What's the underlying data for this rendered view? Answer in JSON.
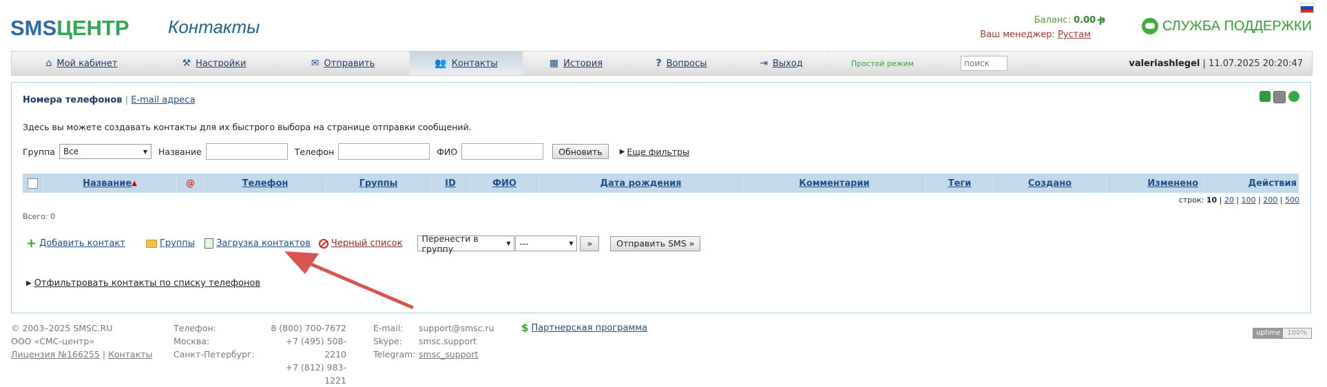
{
  "brand": {
    "sms": "SMS",
    "center": "ЦЕНТР"
  },
  "page_title": "Контакты",
  "balance": {
    "label": "Баланс:",
    "value": "0.00 р"
  },
  "manager": {
    "label": "Ваш менеджер:",
    "name": "Рустам"
  },
  "support": "СЛУЖБА ПОДДЕРЖКИ",
  "nav": {
    "items": [
      {
        "label": "Мой кабинет",
        "icon": "home-icon"
      },
      {
        "label": "Настройки",
        "icon": "tools-icon"
      },
      {
        "label": "Отправить",
        "icon": "envelope-icon"
      },
      {
        "label": "Контакты",
        "icon": "users-icon"
      },
      {
        "label": "История",
        "icon": "calendar-icon"
      },
      {
        "label": "Вопросы",
        "icon": "question-icon"
      },
      {
        "label": "Выход",
        "icon": "logout-icon"
      }
    ],
    "simple_mode": "Простой режим",
    "search_placeholder": "поиск",
    "username": "valeriashlegel",
    "datetime": "11.07.2025 20:20:47"
  },
  "tabs": {
    "phones": "Номера телефонов",
    "separator": "|",
    "emails": "E-mail адреса"
  },
  "intro": "Здесь вы можете создавать контакты для их быстрого выбора на странице отправки сообщений.",
  "filters": {
    "group_label": "Группа",
    "group_value": "Все",
    "name_label": "Название",
    "phone_label": "Телефон",
    "fio_label": "ФИО",
    "refresh_button": "Обновить",
    "more_filters": "Еще фильтры"
  },
  "table": {
    "columns": [
      "Название",
      "@",
      "Телефон",
      "Группы",
      "ID",
      "ФИО",
      "Дата рождения",
      "Комментарии",
      "Теги",
      "Создано",
      "Изменено",
      "Действия"
    ],
    "total": "Всего: 0",
    "rows_label": "строк:",
    "rows_current": "10",
    "rows_options": [
      "20",
      "100",
      "200",
      "500"
    ]
  },
  "actions": {
    "add_contact": "Добавить контакт",
    "groups": "Группы",
    "load_contacts": "Загрузка контактов",
    "blacklist": "Черный список",
    "move_to_group": "Перенести в группу",
    "move_target": "---",
    "go_button": "»",
    "send_sms_button": "Отправить SMS »"
  },
  "filter_by_phones": "Отфильтровать контакты по списку телефонов",
  "footer": {
    "copyright": "© 2003–2025 SMSC.RU",
    "company": "ООО «СМС-центр»",
    "license": "Лицензия №166255",
    "contacts_link": "Контакты",
    "phone_label": "Телефон:",
    "phone_value": "8 (800) 700-7672",
    "moscow_label": "Москва:",
    "moscow_value": "+7 (495) 508-2210",
    "spb_label": "Санкт-Петербург:",
    "spb_value": "+7 (812) 983-1221",
    "email_label": "E-mail:",
    "email_value": "support@smsc.ru",
    "skype_label": "Skype:",
    "skype_value": "smsc.support",
    "telegram_label": "Telegram:",
    "telegram_value": "smsc_support",
    "partner": "Партнерская программа",
    "uptime_label": "uptime",
    "uptime_value": "100%"
  },
  "colors": {
    "brand_blue": "#2a6aa8",
    "brand_green": "#2fa84f",
    "table_header": "#c3d9ec",
    "arrow": "#d9534f"
  }
}
